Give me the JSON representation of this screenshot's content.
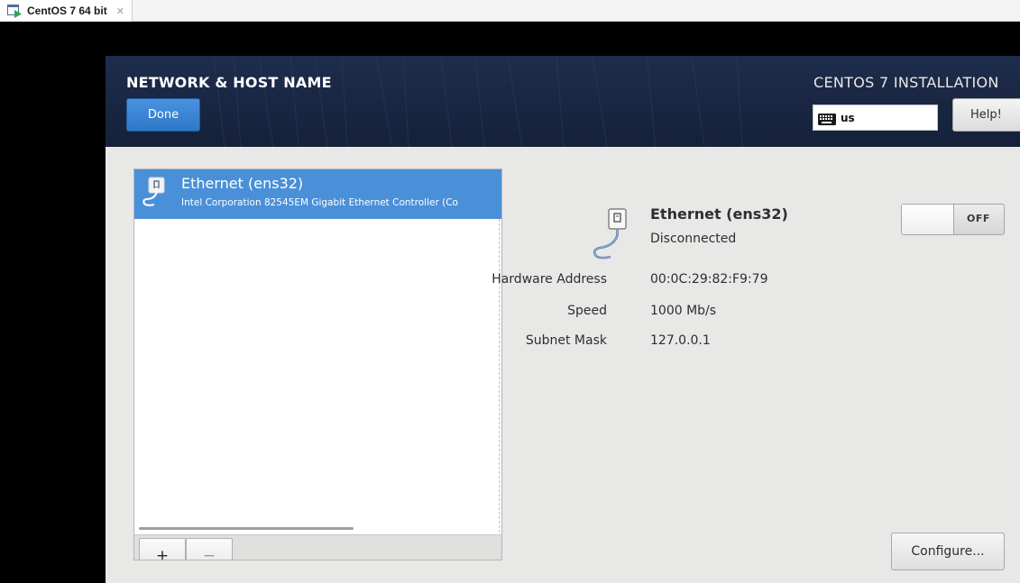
{
  "vm_tab": {
    "icon": "vm-play-icon",
    "title": "CentOS 7 64 bit",
    "close_glyph": "✕"
  },
  "header": {
    "spoke_title": "NETWORK & HOST NAME",
    "done_label": "Done",
    "product_title": "CENTOS 7 INSTALLATION",
    "keyboard_layout": "us",
    "keyboard_icon": "keyboard-icon",
    "help_label": "Help!"
  },
  "device_list": {
    "items": [
      {
        "name": "Ethernet (ens32)",
        "description": "Intel Corporation 82545EM Gigabit Ethernet Controller (Co",
        "icon": "ethernet-cable-icon",
        "selected": true
      }
    ],
    "add_label": "+",
    "remove_label": "−"
  },
  "details": {
    "device_name": "Ethernet (ens32)",
    "status": "Disconnected",
    "properties": [
      {
        "label": "Hardware Address",
        "value": "00:0C:29:82:F9:79"
      },
      {
        "label": "Speed",
        "value": "1000 Mb/s"
      },
      {
        "label": "Subnet Mask",
        "value": "127.0.0.1"
      }
    ],
    "toggle_state": "OFF",
    "configure_label": "Configure..."
  },
  "colors": {
    "accent_blue": "#4a90d9",
    "header_bg": "#1e2d4c",
    "done_button": "#3a86d6"
  }
}
